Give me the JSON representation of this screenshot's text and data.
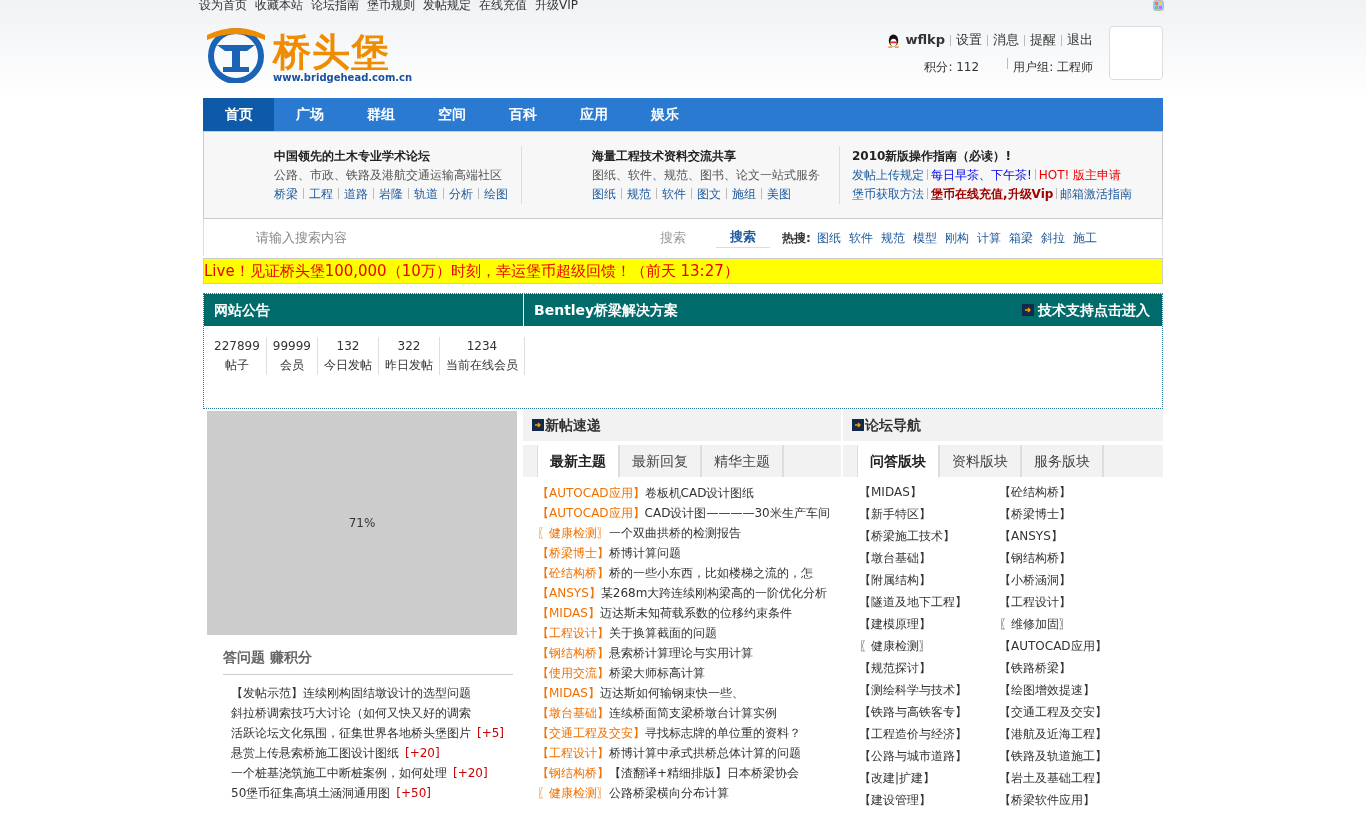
{
  "top_links": [
    "设为首页",
    "收藏本站",
    "论坛指南",
    "堡币规则",
    "发帖规定",
    "在线充值",
    "升级VIP"
  ],
  "logo": {
    "name": "桥头堡",
    "url": "www.bridgehead.com.cn"
  },
  "user": {
    "name": "wflkp",
    "links": [
      "设置",
      "消息",
      "提醒",
      "退出"
    ],
    "points": "积分: 112",
    "group": "用户组: 工程师"
  },
  "nav": [
    {
      "label": "首页",
      "selected": true
    },
    {
      "label": "广场",
      "selected": false
    },
    {
      "label": "群组",
      "selected": false
    },
    {
      "label": "空间",
      "selected": false
    },
    {
      "label": "百科",
      "selected": false
    },
    {
      "label": "应用",
      "selected": false
    },
    {
      "label": "娱乐",
      "selected": false
    }
  ],
  "info_columns": [
    {
      "title": "中国领先的土木专业学术论坛",
      "subtitle": "公路、市政、铁路及港航交通运输高端社区",
      "links": [
        {
          "text": "桥梁"
        },
        {
          "text": "工程"
        },
        {
          "text": "道路"
        },
        {
          "text": "岩隆"
        },
        {
          "text": "轨道"
        },
        {
          "text": "分析"
        },
        {
          "text": "绘图"
        }
      ]
    },
    {
      "title": "海量工程技术资料交流共享",
      "subtitle": "图纸、软件、规范、图书、论文一站式服务",
      "links": [
        {
          "text": "图纸"
        },
        {
          "text": "规范"
        },
        {
          "text": "软件"
        },
        {
          "text": "图文"
        },
        {
          "text": "施组"
        },
        {
          "text": "美图"
        }
      ]
    },
    {
      "title": "2010新版操作指南（必读）!",
      "links": [
        {
          "text": "发帖上传规定",
          "kind": "normal"
        },
        {
          "text": "每日早茶、下午茶!",
          "kind": "notice"
        },
        {
          "text": "HOT! 版主申请",
          "kind": "hot"
        },
        {
          "text": "堡币获取方法",
          "kind": "normal"
        },
        {
          "text": "堡币在线充值,升级Vip",
          "kind": "vip"
        },
        {
          "text": "邮箱激活指南",
          "kind": "normal"
        }
      ]
    }
  ],
  "search": {
    "placeholder": "请输入搜索内容",
    "scope": "搜索",
    "button": "搜索",
    "hot_label": "热搜:",
    "hot": [
      "图纸",
      "软件",
      "规范",
      "模型",
      "刚构",
      "计算",
      "箱梁",
      "斜拉",
      "施工"
    ]
  },
  "announcement": "Live！见证桥头堡100,000（10万）时刻，幸运堡币超级回馈！（前天 13:27）",
  "notice": {
    "title": "网站公告",
    "stats": [
      {
        "value": "227899",
        "label": "帖子"
      },
      {
        "value": "99999",
        "label": "会员"
      },
      {
        "value": "132",
        "label": "今日发帖"
      },
      {
        "value": "322",
        "label": "昨日发帖"
      },
      {
        "value": "1234",
        "label": "当前在线会员"
      }
    ]
  },
  "bentley": {
    "title": "Bentley桥梁解决方案",
    "link": "技术支持点击进入"
  },
  "loading": "71%",
  "qa": {
    "title": "答问题 赚积分",
    "items": [
      {
        "text": "【发帖示范】连续刚构固结墩设计的选型问题"
      },
      {
        "text": "斜拉桥调索技巧大讨论（如何又快又好的调索"
      },
      {
        "text": "活跃论坛文化氛围，征集世界各地桥头堡图片",
        "bonus": "[+5]"
      },
      {
        "text": "悬赏上传悬索桥施工图设计图纸",
        "bonus": "[+20]"
      },
      {
        "text": "一个桩基浇筑施工中断桩案例，如何处理",
        "bonus": "[+20]"
      },
      {
        "text": "50堡币征集高填土涵洞通用图",
        "bonus": "[+50]"
      }
    ]
  },
  "new_posts": {
    "title": "新帖速递",
    "tabs": [
      {
        "label": "最新主题",
        "selected": true
      },
      {
        "label": "最新回复",
        "selected": false
      },
      {
        "label": "精华主题",
        "selected": false
      }
    ],
    "items": [
      {
        "tag": "【AUTOCAD应用】",
        "title": "卷板机CAD设计图纸"
      },
      {
        "tag": "【AUTOCAD应用】",
        "title": "CAD设计图————30米生产车间"
      },
      {
        "tag": "〖健康检测〗",
        "title": "一个双曲拱桥的检测报告"
      },
      {
        "tag": "【桥梁博士】",
        "title": "桥博计算问题"
      },
      {
        "tag": "【砼结构桥】",
        "title": "桥的一些小东西，比如楼梯之流的，怎"
      },
      {
        "tag": "【ANSYS】",
        "title": "某268m大跨连续刚构梁高的一阶优化分析"
      },
      {
        "tag": "【MIDAS】",
        "title": "迈达斯未知荷载系数的位移约束条件"
      },
      {
        "tag": "【工程设计】",
        "title": "关于换算截面的问题"
      },
      {
        "tag": "【钢结构桥】",
        "title": "悬索桥计算理论与实用计算"
      },
      {
        "tag": "【使用交流】",
        "title": "桥梁大师标高计算"
      },
      {
        "tag": "【MIDAS】",
        "title": "迈达斯如何输钢束快一些、"
      },
      {
        "tag": "【墩台基础】",
        "title": "连续桥面简支梁桥墩台计算实例"
      },
      {
        "tag": "【交通工程及交安】",
        "title": "寻找标志牌的单位重的资料？"
      },
      {
        "tag": "【工程设计】",
        "title": "桥博计算中承式拱桥总体计算的问题"
      },
      {
        "tag": "【钢结构桥】",
        "title": "【渣翻译+精细排版】日本桥梁协会"
      },
      {
        "tag": "〖健康检测〗",
        "title": "公路桥梁横向分布计算"
      }
    ]
  },
  "forum_nav": {
    "title": "论坛导航",
    "tabs": [
      {
        "label": "问答版块",
        "selected": true
      },
      {
        "label": "资料版块",
        "selected": false
      },
      {
        "label": "服务版块",
        "selected": false
      }
    ],
    "boards": [
      "【MIDAS】",
      "【砼结构桥】",
      "【新手特区】",
      "【桥梁博士】",
      "【桥梁施工技术】",
      "【ANSYS】",
      "【墩台基础】",
      "【钢结构桥】",
      "【附属结构】",
      "【小桥涵洞】",
      "【隧道及地下工程】",
      "【工程设计】",
      "【建模原理】",
      "〖维修加固〗",
      "〖健康检测〗",
      "【AUTOCAD应用】",
      "【规范探讨】",
      "【铁路桥梁】",
      "【测绘科学与技术】",
      "【绘图增效提速】",
      "【铁路与高铁客专】",
      "【交通工程及交安】",
      "【工程造价与经济】",
      "【港航及近海工程】",
      "【公路与城市道路】",
      "【铁路及轨道施工】",
      "【改建|扩建】",
      "【岩土及基础工程】",
      "【建设管理】",
      "【桥梁软件应用】"
    ]
  }
}
